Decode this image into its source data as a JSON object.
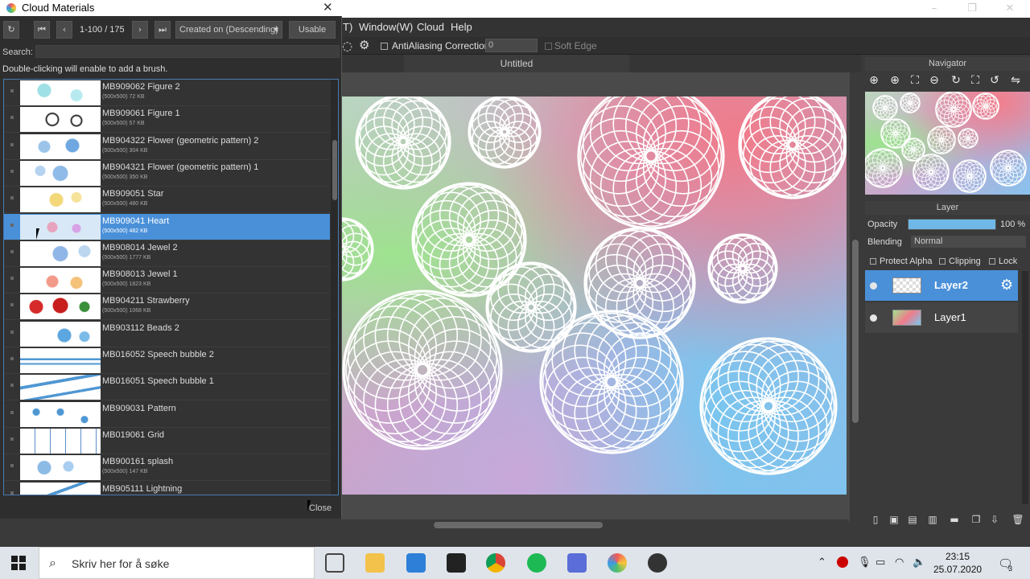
{
  "menu": {
    "items": [
      "T)",
      "Window(W)",
      "Cloud",
      "Help"
    ]
  },
  "toolbar": {
    "antialias": "AntiAliasing",
    "correction_label": "Correction",
    "correction_value": "0",
    "soft_edge": "Soft Edge"
  },
  "document": {
    "tab_title": "Untitled"
  },
  "navigator": {
    "title": "Navigator"
  },
  "layer_panel": {
    "title": "Layer",
    "opacity_label": "Opacity",
    "opacity_value": "100 %",
    "blending_label": "Blending",
    "blending_value": "Normal",
    "protect_alpha": "Protect Alpha",
    "clipping": "Clipping",
    "lock": "Lock",
    "layers": [
      {
        "name": "Layer2",
        "selected": true
      },
      {
        "name": "Layer1",
        "selected": false
      }
    ]
  },
  "dialog": {
    "title": "Cloud Materials",
    "close_x": "✕",
    "pagination": "1-100 / 175",
    "sort": "Created on (Descending)",
    "usable": "Usable",
    "search_label": "Search:",
    "hint": "Double-clicking will enable to add a brush.",
    "close_label": "Close",
    "items": [
      {
        "name": "MB909062 Figure 2",
        "meta": "(500x500) 72 KB"
      },
      {
        "name": "MB909061 Figure 1",
        "meta": "(500x500) 57 KB"
      },
      {
        "name": "MB904322 Flower (geometric pattern) 2",
        "meta": "(500x500) 304 KB"
      },
      {
        "name": "MB904321 Flower (geometric pattern) 1",
        "meta": "(500x500) 350 KB"
      },
      {
        "name": "MB909051 Star",
        "meta": "(500x500) 480 KB"
      },
      {
        "name": "MB909041 Heart",
        "meta": "(500x500) 482 KB",
        "selected": true
      },
      {
        "name": "MB908014 Jewel 2",
        "meta": "(500x500) 1777 KB"
      },
      {
        "name": "MB908013 Jewel 1",
        "meta": "(500x500) 1823 KB"
      },
      {
        "name": "MB904211 Strawberry",
        "meta": "(500x500) 1068 KB"
      },
      {
        "name": "MB903112 Beads 2",
        "meta": ""
      },
      {
        "name": "MB016052 Speech bubble 2",
        "meta": ""
      },
      {
        "name": "MB016051 Speech bubble 1",
        "meta": ""
      },
      {
        "name": "MB909031 Pattern",
        "meta": ""
      },
      {
        "name": "MB019061 Grid",
        "meta": ""
      },
      {
        "name": "MB900161 splash",
        "meta": "(500x500) 147 KB"
      },
      {
        "name": "MB905111 Lightning",
        "meta": ""
      }
    ]
  },
  "taskbar": {
    "search_placeholder": "Skriv her for å søke",
    "time": "23:15",
    "date": "25.07.2020",
    "notification_count": "3"
  },
  "colors": {
    "accent": "#4a90d9",
    "selection": "#4a90d9",
    "opacity_bar": "#6fb8e8"
  }
}
